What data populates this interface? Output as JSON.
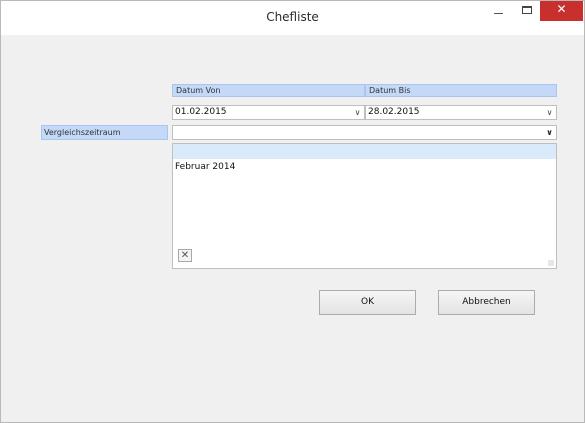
{
  "window": {
    "title": "Chefliste",
    "minimize_glyph": "–",
    "close_glyph": "✕"
  },
  "datum_von": {
    "header": "Datum Von",
    "value": "01.02.2015"
  },
  "datum_bis": {
    "header": "Datum Bis",
    "value": "28.02.2015"
  },
  "vergleichszeitraum": {
    "label": "Vergleichszeitraum",
    "value": ""
  },
  "list": {
    "items": [
      "Februar 2014"
    ]
  },
  "buttons": {
    "ok": "OK",
    "cancel": "Abbrechen"
  },
  "icons": {
    "dropdown": "chevron-down-icon",
    "clear": "close-icon"
  },
  "colors": {
    "header_bg": "#c3d9f7",
    "close_button": "#c7302c",
    "list_header_bg": "#d9ebfb"
  }
}
